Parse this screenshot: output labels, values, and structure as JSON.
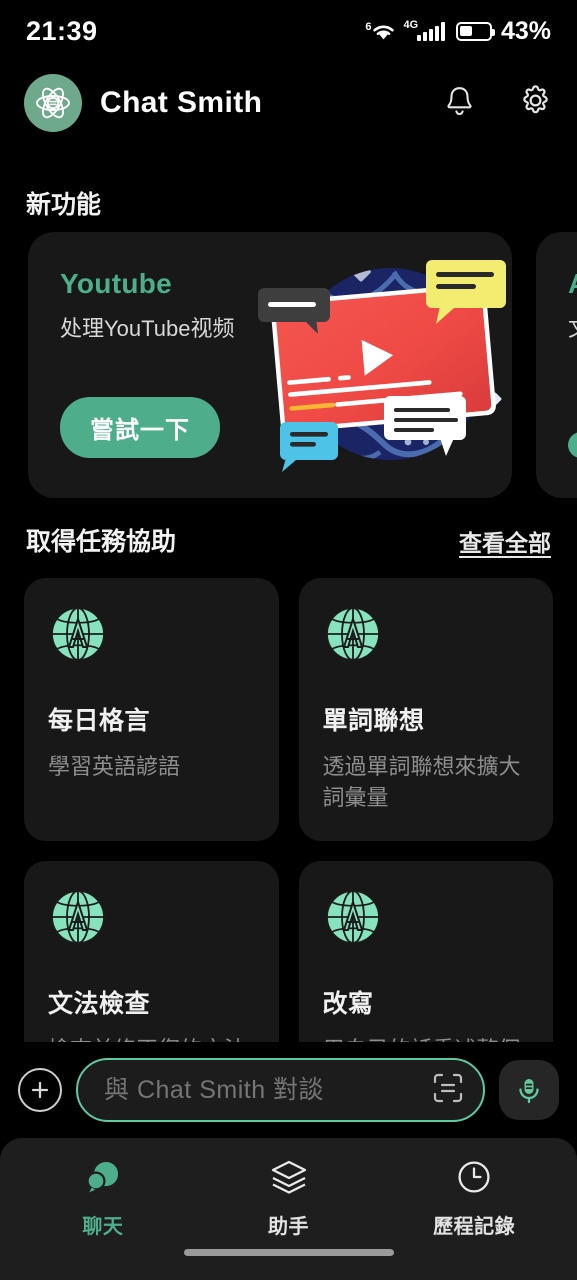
{
  "status_bar": {
    "time": "21:39",
    "wifi_gen": "6",
    "network": "4G",
    "battery_percent": "43%",
    "battery_level": 43
  },
  "header": {
    "app_title": "Chat Smith",
    "logo_icon": "atom-icon",
    "notification_icon": "bell-icon",
    "settings_icon": "gear-icon",
    "logo_color": "#6fa98c"
  },
  "new_features": {
    "section_title": "新功能",
    "cards": [
      {
        "title": "Youtube",
        "subtitle": "处理YouTube视频",
        "button_label": "嘗試一下",
        "art": "youtube-video-globe-illustration"
      },
      {
        "title": "A",
        "subtitle": "文",
        "button_label": "",
        "art": "partial-card"
      }
    ]
  },
  "tasks": {
    "section_title": "取得任務協助",
    "see_all_label": "查看全部",
    "items": [
      {
        "icon": "globe-letter-a-icon",
        "title": "每日格言",
        "subtitle": "學習英語諺語"
      },
      {
        "icon": "globe-letter-a-icon",
        "title": "單詞聯想",
        "subtitle": "透過單詞聯想來擴大詞彙量"
      },
      {
        "icon": "globe-letter-a-icon",
        "title": "文法檢查",
        "subtitle": "檢查並修正您的文法"
      },
      {
        "icon": "globe-letter-a-icon",
        "title": "改寫",
        "subtitle": "用自己的話重述整個段落"
      }
    ]
  },
  "composer": {
    "add_icon": "plus-icon",
    "placeholder": "與 Chat Smith 對談",
    "value": "",
    "scan_icon": "text-scan-icon",
    "mic_icon": "microphone-icon",
    "border_color": "#5fc9a0"
  },
  "bottom_nav": {
    "active_color": "#4eae8b",
    "items": [
      {
        "icon": "chat-bubbles-icon",
        "label": "聊天",
        "active": true
      },
      {
        "icon": "layers-icon",
        "label": "助手",
        "active": false
      },
      {
        "icon": "clock-icon",
        "label": "歷程記錄",
        "active": false
      }
    ]
  }
}
